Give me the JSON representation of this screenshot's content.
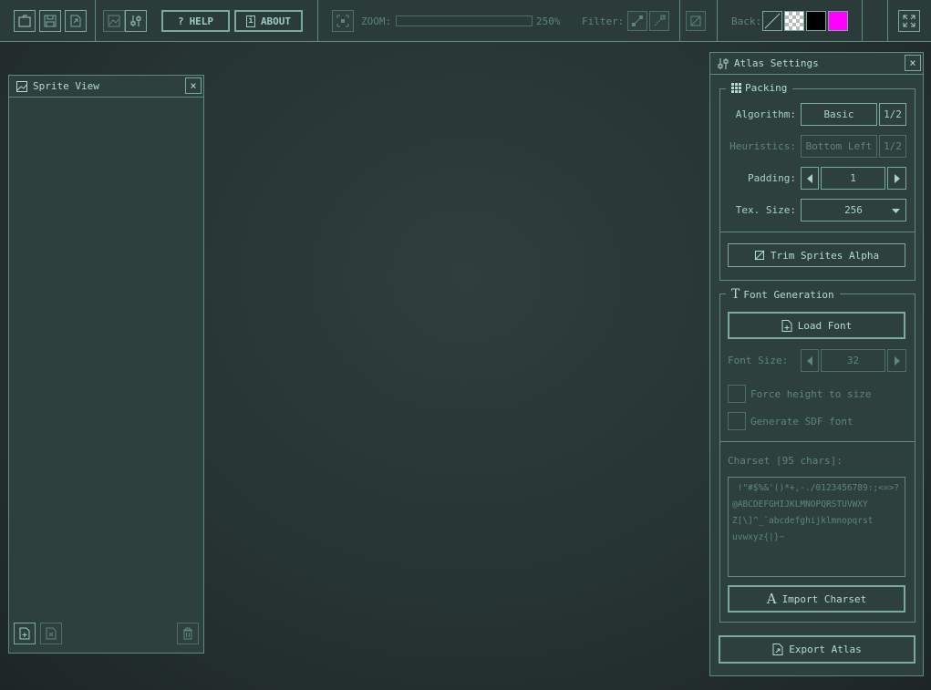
{
  "toolbar": {
    "help_label": "HELP",
    "about_label": "ABOUT",
    "zoom_label": "ZOOM:",
    "zoom_value": "250%",
    "filter_label": "Filter:",
    "back_label": "Back:",
    "back_swatches": [
      "none",
      "checker",
      "#000000",
      "#ff00ff"
    ]
  },
  "sprite_view": {
    "title": "Sprite View"
  },
  "atlas_settings": {
    "title": "Atlas Settings",
    "packing": {
      "title": "Packing",
      "algorithm_label": "Algorithm:",
      "algorithm_value": "Basic",
      "algorithm_page": "1/2",
      "heuristics_label": "Heuristics:",
      "heuristics_value": "Bottom Left",
      "heuristics_page": "1/2",
      "padding_label": "Padding:",
      "padding_value": "1",
      "tex_size_label": "Tex. Size:",
      "tex_size_value": "256",
      "trim_label": "Trim Sprites Alpha"
    },
    "font": {
      "title": "Font Generation",
      "load_font_label": "Load Font",
      "font_size_label": "Font Size:",
      "font_size_value": "32",
      "force_height_label": "Force height to size",
      "sdf_label": "Generate SDF font",
      "charset_label": "Charset [95 chars]:",
      "charset_lines": [
        " !\"#$%&'()*+,-./0123456789:;<=>?",
        "@ABCDEFGHIJKLMNOPQRSTUVWXY",
        "Z[\\]^_`abcdefghijklmnopqrst",
        "uvwxyz{|}~"
      ],
      "import_label": "Import Charset"
    },
    "export_label": "Export Atlas"
  }
}
